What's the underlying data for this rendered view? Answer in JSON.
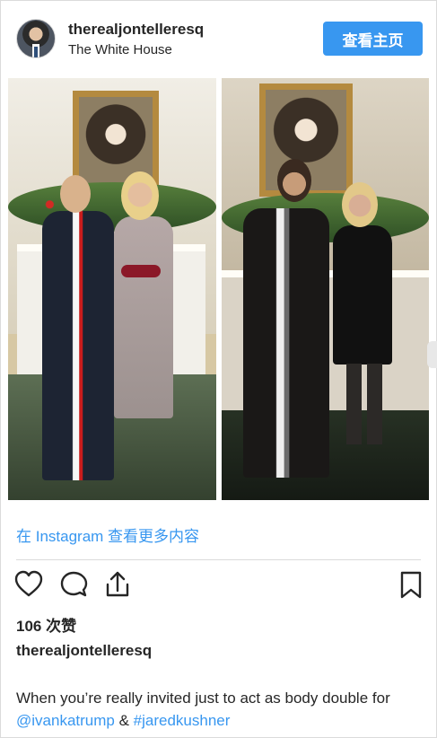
{
  "post": {
    "username": "therealjontelleresq",
    "location": "The White House",
    "profile_button_label": "查看主页",
    "instagram_link_label": "在 Instagram 查看更多内容",
    "likes_text": "106 次赞",
    "caption_owner": "therealjontelleresq",
    "caption_before": "When you’re really invited just to act as body double for ",
    "mention": "@ivankatrump",
    "caption_between": " & ",
    "hashtag": "#jaredkushner"
  },
  "icons": {
    "heart": "heart-icon",
    "comment": "comment-icon",
    "share": "share-icon",
    "bookmark": "bookmark-icon"
  },
  "colors": {
    "accent": "#3897f0",
    "text": "#262626",
    "border": "#dbdbdb"
  }
}
